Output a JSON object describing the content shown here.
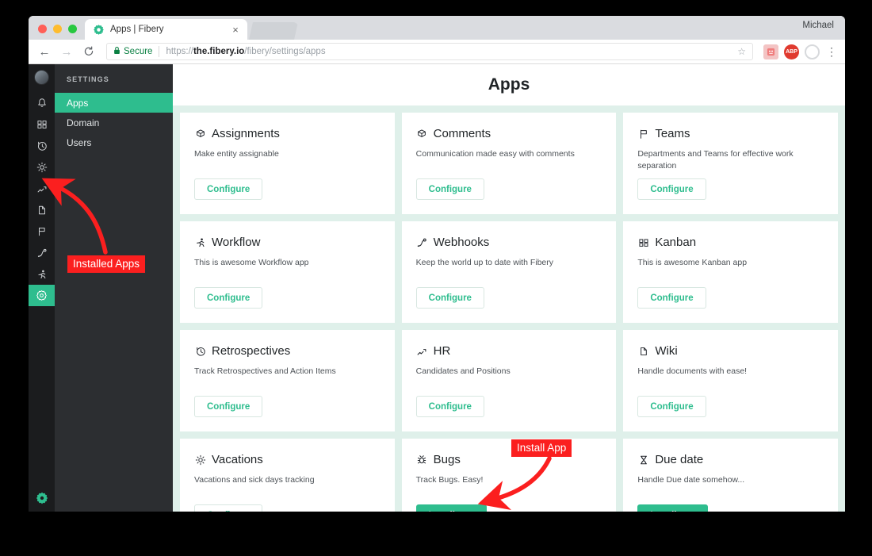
{
  "browser": {
    "tab_title": "Apps | Fibery",
    "tab_favicon_name": "fibery-gear-favicon",
    "close_label": "×",
    "profile_name": "Michael",
    "back_label": "←",
    "forward_label": "→",
    "reload_label": "↻",
    "lock_label": "🔒",
    "secure_label": "Secure",
    "url_prefix": "https://",
    "url_domain": "the.fibery.io",
    "url_path": "/fibery/settings/apps",
    "star_label": "☆",
    "ext_1_label": "😃",
    "ext_2_label": "ABP",
    "menu_label": "⋮"
  },
  "rail": {
    "avatar_name": "user-avatar",
    "items": [
      {
        "name": "notifications-icon",
        "glyph": "♩",
        "active": false
      },
      {
        "name": "kanban-icon",
        "glyph": "∷",
        "active": false
      },
      {
        "name": "history-clock-icon",
        "glyph": "↺",
        "active": false
      },
      {
        "name": "vacations-sun-icon",
        "glyph": "☀",
        "active": false
      },
      {
        "name": "hr-chart-icon",
        "glyph": "↗",
        "active": false
      },
      {
        "name": "wiki-page-icon",
        "glyph": "◱",
        "active": false
      },
      {
        "name": "teams-flag-icon",
        "glyph": "⚑",
        "active": false
      },
      {
        "name": "webhooks-hook-icon",
        "glyph": "∫",
        "active": false
      },
      {
        "name": "workflow-runner-icon",
        "glyph": "☵",
        "active": false
      },
      {
        "name": "settings-gear-icon",
        "glyph": "⚙",
        "active": true
      }
    ],
    "bottom_icon_name": "fibery-logo-icon"
  },
  "sidebar": {
    "heading": "SETTINGS",
    "items": [
      {
        "label": "Apps",
        "active": true
      },
      {
        "label": "Domain",
        "active": false
      },
      {
        "label": "Users",
        "active": false
      }
    ]
  },
  "main": {
    "title": "Apps",
    "cards": [
      {
        "icon": "cube-icon",
        "title": "Assignments",
        "desc": "Make entity assignable",
        "button": "Configure",
        "installed": true
      },
      {
        "icon": "cube-icon",
        "title": "Comments",
        "desc": "Communication made easy with comments",
        "button": "Configure",
        "installed": true
      },
      {
        "icon": "flag-icon",
        "title": "Teams",
        "desc": "Departments and Teams for effective work separation",
        "button": "Configure",
        "installed": true
      },
      {
        "icon": "runner-icon",
        "title": "Workflow",
        "desc": "This is awesome Workflow app",
        "button": "Configure",
        "installed": true
      },
      {
        "icon": "hook-icon",
        "title": "Webhooks",
        "desc": "Keep the world up to date with Fibery",
        "button": "Configure",
        "installed": true
      },
      {
        "icon": "kanban-icon",
        "title": "Kanban",
        "desc": "This is awesome Kanban app",
        "button": "Configure",
        "installed": true
      },
      {
        "icon": "clock-icon",
        "title": "Retrospectives",
        "desc": "Track Retrospectives and Action Items",
        "button": "Configure",
        "installed": true
      },
      {
        "icon": "trend-icon",
        "title": "HR",
        "desc": "Candidates and Positions",
        "button": "Configure",
        "installed": true
      },
      {
        "icon": "page-icon",
        "title": "Wiki",
        "desc": "Handle documents with ease!",
        "button": "Configure",
        "installed": true
      },
      {
        "icon": "sun-icon",
        "title": "Vacations",
        "desc": "Vacations and sick days tracking",
        "button": "Configure",
        "installed": true
      },
      {
        "icon": "bug-icon",
        "title": "Bugs",
        "desc": "Track Bugs. Easy!",
        "button": "Install app",
        "installed": false
      },
      {
        "icon": "hourglass-icon",
        "title": "Due date",
        "desc": "Handle Due date somehow...",
        "button": "Install app",
        "installed": false
      }
    ]
  },
  "annotations": {
    "installed_apps": "Installed Apps",
    "install_app": "Install App",
    "color": "#fb1f1f"
  },
  "theme": {
    "accent_green": "#2ebd8e",
    "page_tint": "#dff0ea",
    "rail_dark": "#1b1c1e",
    "nav_dark": "#2c2e31"
  }
}
